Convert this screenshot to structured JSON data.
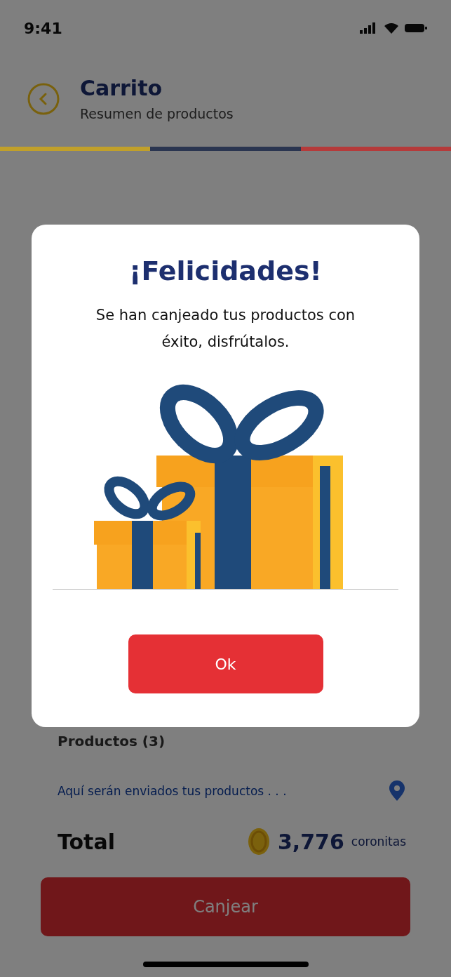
{
  "status_bar": {
    "time": "9:41"
  },
  "header": {
    "title": "Carrito",
    "subtitle": "Resumen de productos"
  },
  "progress_segments": [
    {
      "color": "#c1a02a"
    },
    {
      "color": "#2a3550"
    },
    {
      "color": "#b53a3a"
    }
  ],
  "summary": {
    "products_label": "Productos (3)",
    "address_link": "Aquí serán enviados tus productos . . .",
    "total_label": "Total",
    "total_amount": "3,776",
    "currency": "coronitas"
  },
  "primary_button": "Canjear",
  "dialog": {
    "title": "¡Felicidades!",
    "message": "Se han canjeado tus productos con éxito, disfrútalos.",
    "button": "Ok"
  }
}
